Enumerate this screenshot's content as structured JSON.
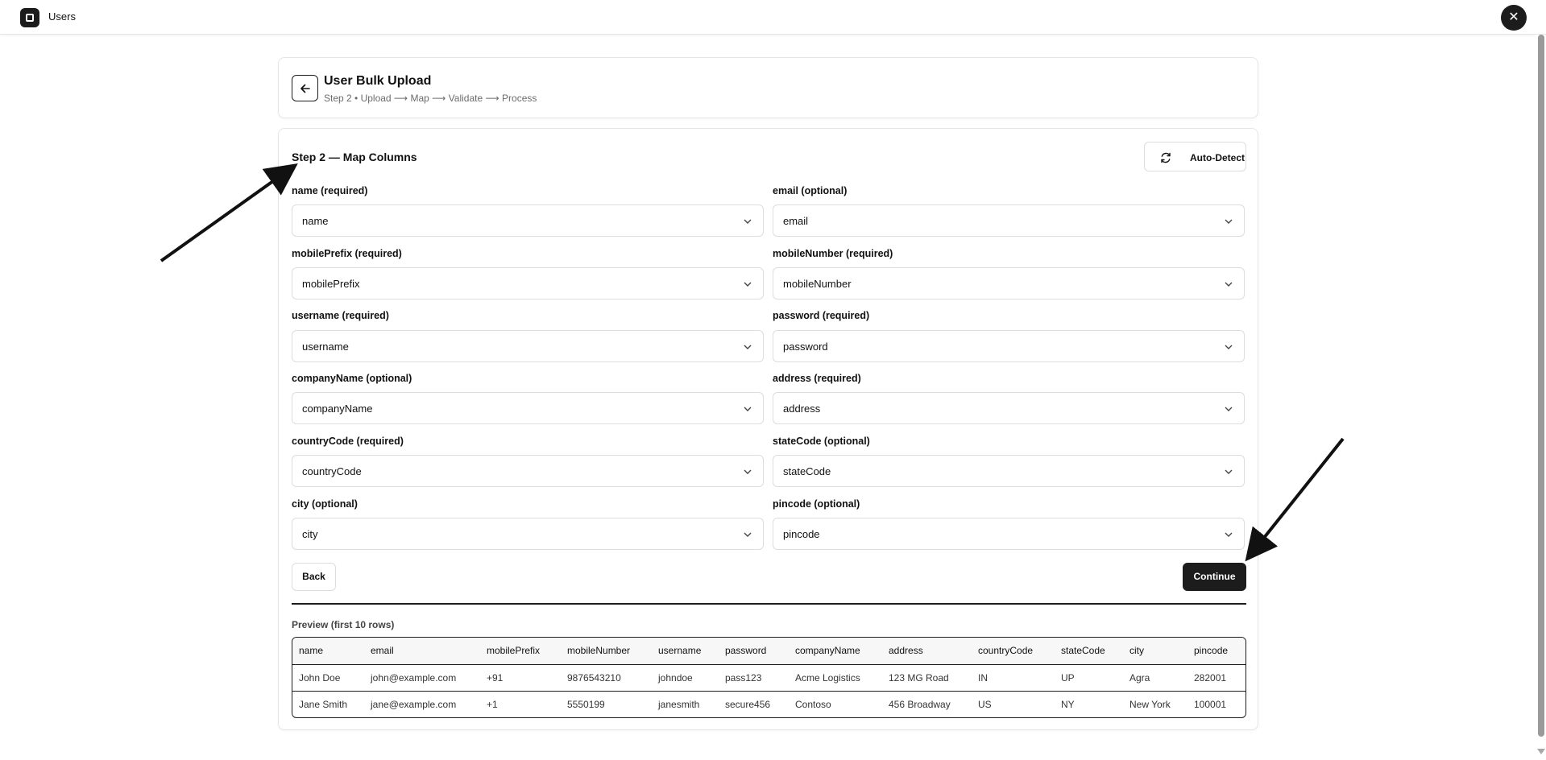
{
  "app": {
    "title": "Users",
    "icon": "square-app-icon",
    "close_icon": "close-icon"
  },
  "header": {
    "title": "User Bulk Upload",
    "subtitle": "Step 2 • Upload ⟶ Map ⟶ Validate ⟶ Process",
    "back_icon": "arrow-left-icon"
  },
  "step": {
    "title": "Step 2 — Map Columns",
    "autodetect_label": "Auto-Detect",
    "autodetect_icon": "refresh-icon"
  },
  "fields": [
    {
      "label": "name (required)",
      "value": "name"
    },
    {
      "label": "email (optional)",
      "value": "email"
    },
    {
      "label": "mobilePrefix (required)",
      "value": "mobilePrefix"
    },
    {
      "label": "mobileNumber (required)",
      "value": "mobileNumber"
    },
    {
      "label": "username (required)",
      "value": "username"
    },
    {
      "label": "password (required)",
      "value": "password"
    },
    {
      "label": "companyName (optional)",
      "value": "companyName"
    },
    {
      "label": "address (required)",
      "value": "address"
    },
    {
      "label": "countryCode (required)",
      "value": "countryCode"
    },
    {
      "label": "stateCode (optional)",
      "value": "stateCode"
    },
    {
      "label": "city (optional)",
      "value": "city"
    },
    {
      "label": "pincode (optional)",
      "value": "pincode"
    }
  ],
  "actions": {
    "back_label": "Back",
    "continue_label": "Continue"
  },
  "preview": {
    "label": "Preview (first 10 rows)",
    "columns": [
      "name",
      "email",
      "mobilePrefix",
      "mobileNumber",
      "username",
      "password",
      "companyName",
      "address",
      "countryCode",
      "stateCode",
      "city",
      "pincode"
    ],
    "rows": [
      [
        "John Doe",
        "john@example.com",
        "+91",
        "9876543210",
        "johndoe",
        "pass123",
        "Acme Logistics",
        "123 MG Road",
        "IN",
        "UP",
        "Agra",
        "282001"
      ],
      [
        "Jane Smith",
        "jane@example.com",
        "+1",
        "5550199",
        "janesmith",
        "secure456",
        "Contoso",
        "456 Broadway",
        "US",
        "NY",
        "New York",
        "100001"
      ]
    ]
  },
  "colors": {
    "primary": "#1c1c1c",
    "border": "#dddddd",
    "muted_text": "#6b6b6b"
  }
}
